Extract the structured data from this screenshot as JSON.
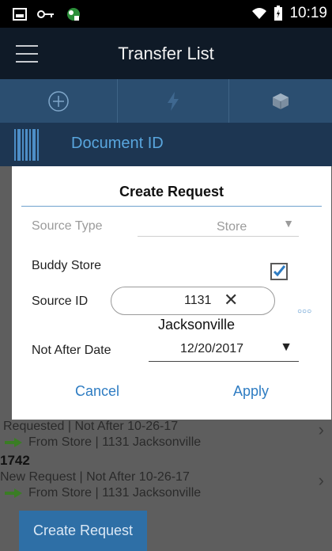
{
  "status_bar": {
    "time": "10:19"
  },
  "app_bar": {
    "title": "Transfer List"
  },
  "toolbar": {
    "icons": [
      "add-circle-icon",
      "lightning-icon",
      "cube-icon"
    ]
  },
  "scan": {
    "label": "Document ID"
  },
  "list": {
    "rows": [
      {
        "doc_id": "",
        "meta": "Requested  |  Not After 10-26-17",
        "from": "From Store | 1131 Jacksonville"
      },
      {
        "doc_id": "1742",
        "meta": "New Request  |  Not After 10-26-17",
        "from": "From Store | 1131 Jacksonville"
      }
    ]
  },
  "create_button_label": "Create Request",
  "dialog": {
    "title": "Create Request",
    "source_type_label": "Source Type",
    "source_type_value": "Store",
    "buddy_store_label": "Buddy Store",
    "buddy_store_checked": true,
    "source_id_label": "Source ID",
    "source_id_value": "1131",
    "source_name": "Jacksonville",
    "not_after_label": "Not After Date",
    "not_after_value": "12/20/2017",
    "cancel_label": "Cancel",
    "apply_label": "Apply"
  },
  "colors": {
    "accent": "#2e7cc2",
    "toolbar": "#2b4e70",
    "app_bar": "#0f1a27"
  }
}
